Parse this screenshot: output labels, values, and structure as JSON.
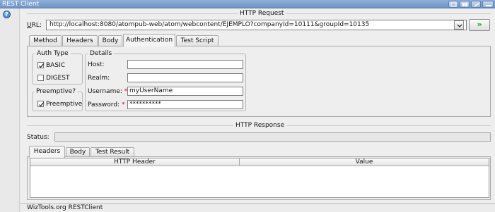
{
  "window": {
    "title": "REST Client"
  },
  "request": {
    "section_title": "HTTP Request",
    "url_label_u": "U",
    "url_label_rest": "RL:",
    "url_value": "http://localhost:8080/atompub-web/atom/webcontent/EJEMPLO?companyId=10111&groupId=10135",
    "go_label": "»",
    "tabs": [
      {
        "label": "Method"
      },
      {
        "label": "Headers"
      },
      {
        "label": "Body"
      },
      {
        "label": "Authentication"
      },
      {
        "label": "Test Script"
      }
    ],
    "selected_tab": "Authentication",
    "auth": {
      "auth_type_title": "Auth Type",
      "basic_label": "BASIC",
      "basic_checked": true,
      "digest_label": "DIGEST",
      "digest_checked": false,
      "preemptive_title": "Preemptive?",
      "preemptive_label": "Preemptive",
      "preemptive_checked": true,
      "details_title": "Details",
      "host_label": "Host:",
      "host_value": "",
      "realm_label": "Realm:",
      "realm_value": "",
      "username_label": "Username:",
      "username_value": "myUserName",
      "password_label": "Password:",
      "password_value": "**********",
      "required_mark": "*"
    }
  },
  "response": {
    "section_title": "HTTP Response",
    "status_label": "Status:",
    "status_value": "",
    "tabs": [
      {
        "label": "Headers"
      },
      {
        "label": "Body"
      },
      {
        "label": "Test Result"
      }
    ],
    "selected_tab": "Headers",
    "columns": [
      "HTTP Header",
      "Value"
    ]
  },
  "statusbar": {
    "text": "WizTools.org RESTClient"
  }
}
